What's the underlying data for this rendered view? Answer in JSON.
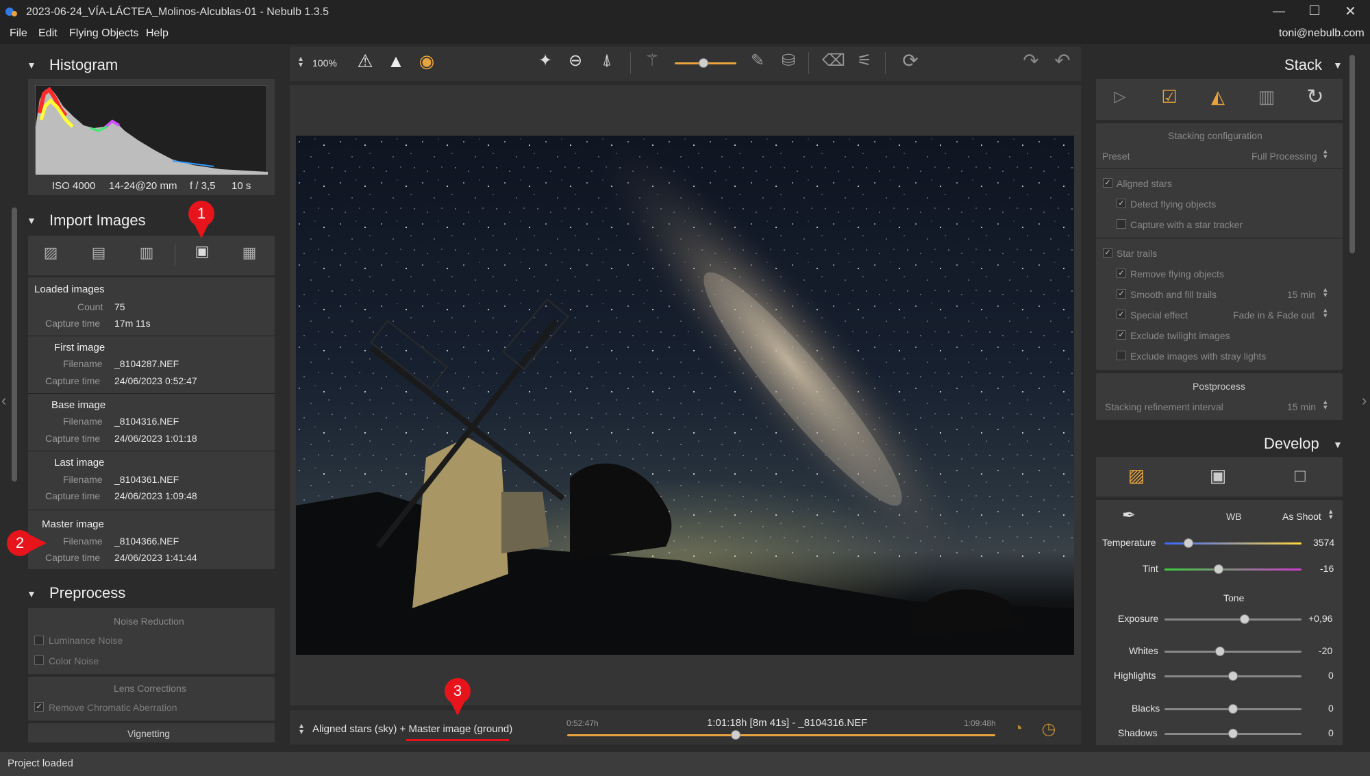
{
  "app": {
    "title": "2023-06-24_VÍA-LÁCTEA_Molinos-Alcublas-01 - Nebulb 1.3.5",
    "user": "toni@nebulb.com"
  },
  "menu": [
    "File",
    "Edit",
    "Flying Objects",
    "Help"
  ],
  "toolbar": {
    "zoom": "100%"
  },
  "histogram": {
    "title": "Histogram",
    "iso": "ISO 4000",
    "lens": "14-24@20 mm",
    "aperture": "f / 3,5",
    "exposure": "10 s"
  },
  "import": {
    "title": "Import Images",
    "loaded": {
      "heading": "Loaded images",
      "count_label": "Count",
      "count": "75",
      "capture_label": "Capture time",
      "capture": "17m 11s"
    },
    "first": {
      "heading": "First image",
      "file_label": "Filename",
      "file": "_8104287.NEF",
      "cap_label": "Capture time",
      "cap": "24/06/2023 0:52:47"
    },
    "base": {
      "heading": "Base image",
      "file_label": "Filename",
      "file": "_8104316.NEF",
      "cap_label": "Capture time",
      "cap": "24/06/2023 1:01:18"
    },
    "last": {
      "heading": "Last image",
      "file_label": "Filename",
      "file": "_8104361.NEF",
      "cap_label": "Capture time",
      "cap": "24/06/2023 1:09:48"
    },
    "master": {
      "heading": "Master image",
      "file_label": "Filename",
      "file": "_8104366.NEF",
      "cap_label": "Capture time",
      "cap": "24/06/2023 1:41:44"
    }
  },
  "preprocess": {
    "title": "Preprocess",
    "noise": "Noise Reduction",
    "lum": "Luminance Noise",
    "color": "Color Noise",
    "lens": "Lens Corrections",
    "chrom": "Remove Chromatic Aberration",
    "vignetting": "Vignetting"
  },
  "timeline": {
    "mode": "Aligned stars (sky) + Master image (ground)",
    "start": "0:52:47h",
    "current": "1:01:18h [8m 41s] - _8104316.NEF",
    "end": "1:09:48h",
    "position": 0.39
  },
  "stack": {
    "title": "Stack",
    "config": "Stacking configuration",
    "preset_label": "Preset",
    "preset": "Full Processing",
    "aligned": "Aligned stars",
    "detect": "Detect flying objects",
    "tracker": "Capture with a star tracker",
    "trails": "Star trails",
    "remove": "Remove flying objects",
    "smooth": "Smooth and fill trails",
    "smooth_val": "15 min",
    "special": "Special effect",
    "special_val": "Fade in & Fade out",
    "twilight": "Exclude twilight images",
    "stray": "Exclude images with stray lights",
    "post": "Postprocess",
    "refine": "Stacking refinement interval",
    "refine_val": "15 min"
  },
  "develop": {
    "title": "Develop",
    "wb_label": "WB",
    "wb": "As Shoot",
    "temp_label": "Temperature",
    "temp": "3574",
    "tint_label": "Tint",
    "tint": "-16",
    "tone": "Tone",
    "exp_label": "Exposure",
    "exp": "+0,96",
    "whites_label": "Whites",
    "whites": "-20",
    "high_label": "Highlights",
    "high": "0",
    "blacks_label": "Blacks",
    "blacks": "0",
    "shadows_label": "Shadows",
    "shadows": "0"
  },
  "markers": [
    "1",
    "2",
    "3"
  ],
  "status": "Project loaded",
  "colors": {
    "accent": "#e8a33d",
    "marker": "#e8141b"
  }
}
